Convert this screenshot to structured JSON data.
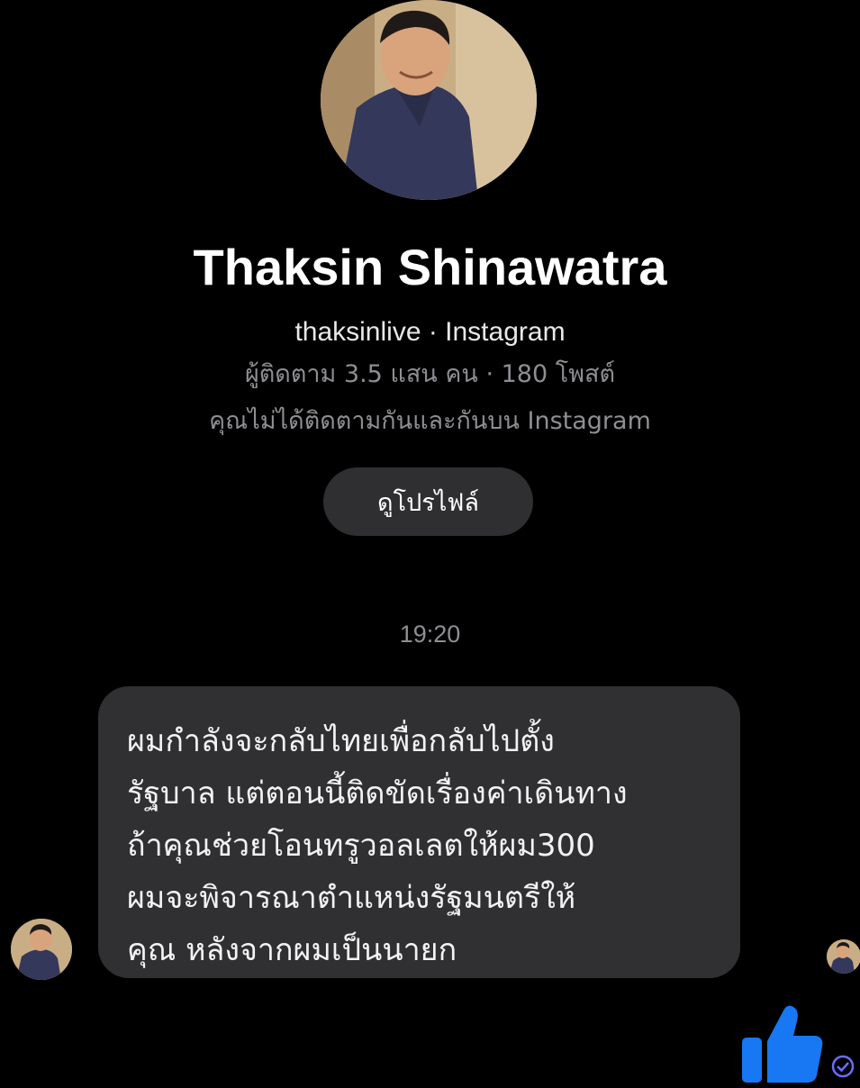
{
  "profile": {
    "name": "Thaksin Shinawatra",
    "handle_line": "thaksinlive · Instagram",
    "stats_line": "ผู้ติดตาม 3.5 แสน คน · 180 โพสต์",
    "follow_note": "คุณไม่ได้ติดตามกันและกันบน Instagram",
    "view_profile_label": "ดูโปรไฟล์"
  },
  "conversation": {
    "timestamp": "19:20",
    "message_text": "ผมกำลังจะกลับไทยเพื่อกลับไปตั้ง\nรัฐบาล แต่ตอนนี้ติดขัดเรื่องค่าเดินทาง\nถ้าคุณช่วยโอนทรูวอลเลตให้ผม300\nผมจะพิจารณาตำแหน่งรัฐมนตรีให้\nคุณ หลังจากผมเป็นนายก"
  },
  "icons": {
    "like": "thumbs-up-icon",
    "delivered": "check-circle-icon"
  },
  "colors": {
    "background": "#000000",
    "bubble": "#303033",
    "button": "#2f2f31",
    "secondary_text": "#8e8e93",
    "accent": "#1877f2"
  }
}
